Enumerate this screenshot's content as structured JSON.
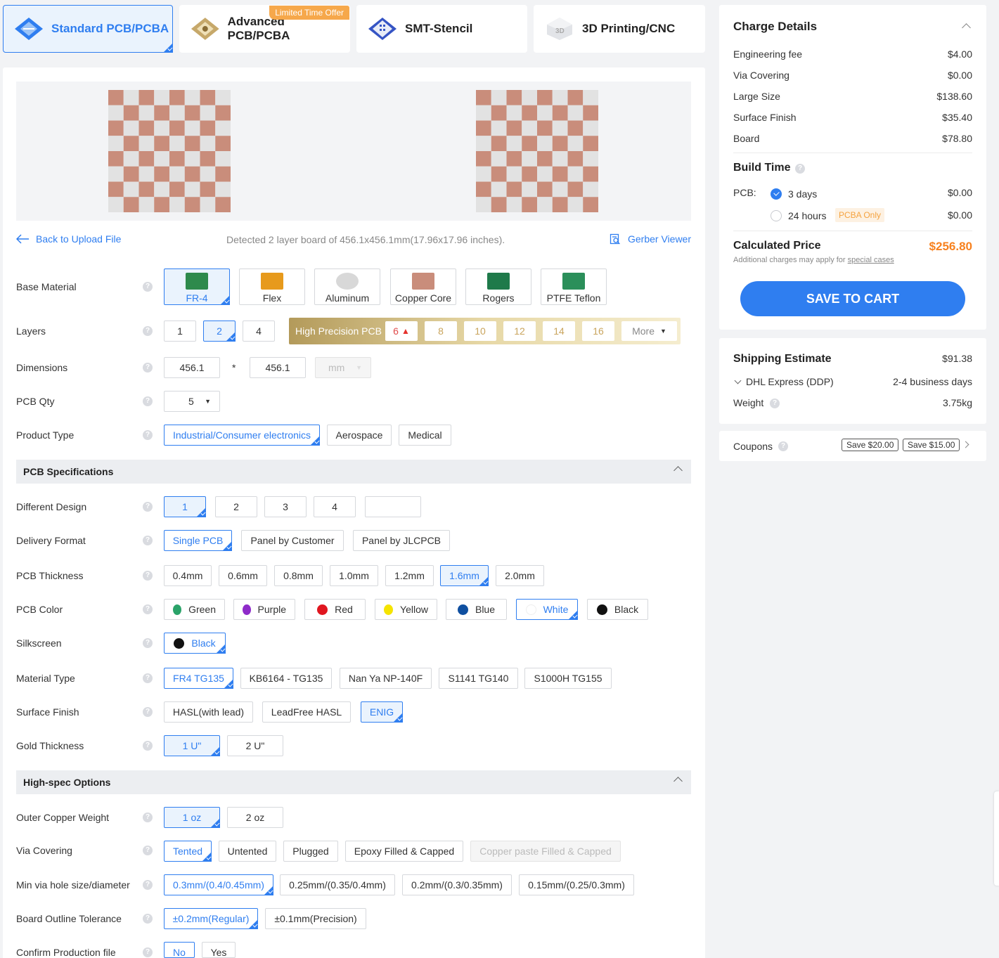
{
  "tabs": [
    {
      "label": "Standard PCB/PCBA"
    },
    {
      "label": "Advanced PCB/PCBA",
      "badge": "Limited Time Offer"
    },
    {
      "label": "SMT-Stencil"
    },
    {
      "label": "3D Printing/CNC"
    }
  ],
  "upload": {
    "back_label": "Back to Upload File",
    "detected": "Detected 2 layer board of 456.1x456.1mm(17.96x17.96 inches).",
    "gerber_label": "Gerber Viewer"
  },
  "form": {
    "base_material": {
      "label": "Base Material",
      "options": [
        "FR-4",
        "Flex",
        "Aluminum",
        "Copper Core",
        "Rogers",
        "PTFE Teflon"
      ],
      "selected": "FR-4"
    },
    "layers": {
      "label": "Layers",
      "options": [
        "1",
        "2",
        "4"
      ],
      "selected": "2",
      "high_precision_label": "High Precision PCB",
      "hp_options": [
        "6",
        "8",
        "10",
        "12",
        "14",
        "16"
      ],
      "more_label": "More"
    },
    "dimensions": {
      "label": "Dimensions",
      "width": "456.1",
      "height": "456.1",
      "sep": "*",
      "unit": "mm"
    },
    "qty": {
      "label": "PCB Qty",
      "value": "5"
    },
    "product_type": {
      "label": "Product Type",
      "options": [
        "Industrial/Consumer electronics",
        "Aerospace",
        "Medical"
      ],
      "selected": "Industrial/Consumer electronics"
    },
    "spec_section": "PCB Specifications",
    "different_design": {
      "label": "Different Design",
      "options": [
        "1",
        "2",
        "3",
        "4"
      ],
      "selected": "1"
    },
    "delivery_format": {
      "label": "Delivery Format",
      "options": [
        "Single PCB",
        "Panel by Customer",
        "Panel by JLCPCB"
      ],
      "selected": "Single PCB"
    },
    "thickness": {
      "label": "PCB Thickness",
      "options": [
        "0.4mm",
        "0.6mm",
        "0.8mm",
        "1.0mm",
        "1.2mm",
        "1.6mm",
        "2.0mm"
      ],
      "selected": "1.6mm"
    },
    "color": {
      "label": "PCB Color",
      "options": [
        {
          "name": "Green",
          "color": "#2ba369"
        },
        {
          "name": "Purple",
          "color": "#8e2bc9"
        },
        {
          "name": "Red",
          "color": "#e0161f"
        },
        {
          "name": "Yellow",
          "color": "#f5e400"
        },
        {
          "name": "Blue",
          "color": "#0f4fa0"
        },
        {
          "name": "White",
          "color": "#ffffff"
        },
        {
          "name": "Black",
          "color": "#111111"
        }
      ],
      "selected": "White"
    },
    "silkscreen": {
      "label": "Silkscreen",
      "value": "Black"
    },
    "material_type": {
      "label": "Material Type",
      "options": [
        "FR4 TG135",
        "KB6164 - TG135",
        "Nan Ya NP-140F",
        "S1141 TG140",
        "S1000H TG155"
      ],
      "selected": "FR4 TG135"
    },
    "surface_finish": {
      "label": "Surface Finish",
      "options": [
        "HASL(with lead)",
        "LeadFree HASL",
        "ENIG"
      ],
      "selected": "ENIG"
    },
    "gold_thickness": {
      "label": "Gold Thickness",
      "options": [
        "1 U\"",
        "2 U\""
      ],
      "selected": "1 U\""
    },
    "highspec_section": "High-spec Options",
    "copper_weight": {
      "label": "Outer Copper Weight",
      "options": [
        "1 oz",
        "2 oz"
      ],
      "selected": "1 oz"
    },
    "via_covering": {
      "label": "Via Covering",
      "options": [
        "Tented",
        "Untented",
        "Plugged",
        "Epoxy Filled & Capped",
        "Copper paste Filled & Capped"
      ],
      "selected": "Tented"
    },
    "min_via": {
      "label": "Min via hole size/diameter",
      "options": [
        "0.3mm/(0.4/0.45mm)",
        "0.25mm/(0.35/0.4mm)",
        "0.2mm/(0.3/0.35mm)",
        "0.15mm/(0.25/0.3mm)"
      ],
      "selected": "0.3mm/(0.4/0.45mm)"
    },
    "outline_tolerance": {
      "label": "Board Outline Tolerance",
      "options": [
        "±0.2mm(Regular)",
        "±0.1mm(Precision)"
      ],
      "selected": "±0.2mm(Regular)"
    },
    "confirm_file": {
      "label": "Confirm Production file",
      "options": [
        "No",
        "Yes"
      ],
      "selected": "No"
    }
  },
  "charges": {
    "title": "Charge Details",
    "items": [
      {
        "name": "Engineering fee",
        "value": "$4.00"
      },
      {
        "name": "Via Covering",
        "value": "$0.00"
      },
      {
        "name": "Large Size",
        "value": "$138.60"
      },
      {
        "name": "Surface Finish",
        "value": "$35.40"
      },
      {
        "name": "Board",
        "value": "$78.80"
      }
    ],
    "build_time_title": "Build Time",
    "pcb_label": "PCB:",
    "build_options": [
      {
        "name": "3 days",
        "value": "$0.00"
      },
      {
        "name": "24 hours",
        "value": "$0.00",
        "badge": "PCBA Only"
      }
    ],
    "calc_label": "Calculated Price",
    "calc_value": "$256.80",
    "note": "Additional charges may apply for",
    "note_link": "special cases",
    "cart_label": "SAVE TO CART"
  },
  "shipping": {
    "title": "Shipping Estimate",
    "value": "$91.38",
    "method": "DHL Express (DDP)",
    "days": "2-4 business days",
    "weight_label": "Weight",
    "weight_value": "3.75kg"
  },
  "coupons": {
    "label": "Coupons",
    "items": [
      "Save $20.00",
      "Save $15.00"
    ]
  },
  "colors": {
    "accent": "#2f7ef0",
    "price": "#f7811e",
    "copper": "#c98d7b"
  }
}
